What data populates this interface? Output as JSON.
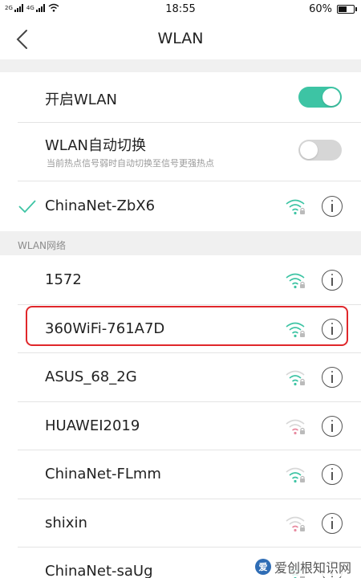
{
  "status_bar": {
    "network_left": "2G",
    "network_right": "4G",
    "time": "18:55",
    "battery_text": "60%",
    "battery_level": 0.6
  },
  "header": {
    "title": "WLAN"
  },
  "wlan_toggle": {
    "label": "开启WLAN",
    "state": "on"
  },
  "auto_switch": {
    "label": "WLAN自动切换",
    "description": "当前热点信号弱时自动切换至信号更强热点",
    "state": "off"
  },
  "connected": {
    "ssid": "ChinaNet-ZbX6",
    "status": "connected"
  },
  "section_header": "WLAN网络",
  "networks": [
    {
      "ssid": "1572",
      "signal": "strong",
      "color": "#3dc4a4"
    },
    {
      "ssid": "360WiFi-761A7D",
      "signal": "strong",
      "color": "#3dc4a4",
      "highlighted": true
    },
    {
      "ssid": "ASUS_68_2G",
      "signal": "medium",
      "color": "#3dc4a4"
    },
    {
      "ssid": "HUAWEI2019",
      "signal": "weak",
      "color": "#e88aa0"
    },
    {
      "ssid": "ChinaNet-FLmm",
      "signal": "medium",
      "color": "#3dc4a4"
    },
    {
      "ssid": "shixin",
      "signal": "weak",
      "color": "#e88aa0"
    },
    {
      "ssid": "ChinaNet-saUg",
      "signal": "medium",
      "color": "#3dc4a4"
    }
  ],
  "watermark": {
    "text": "爱创根知识网"
  },
  "colors": {
    "accent": "#3dc4a4",
    "highlight_border": "#e0272b"
  }
}
